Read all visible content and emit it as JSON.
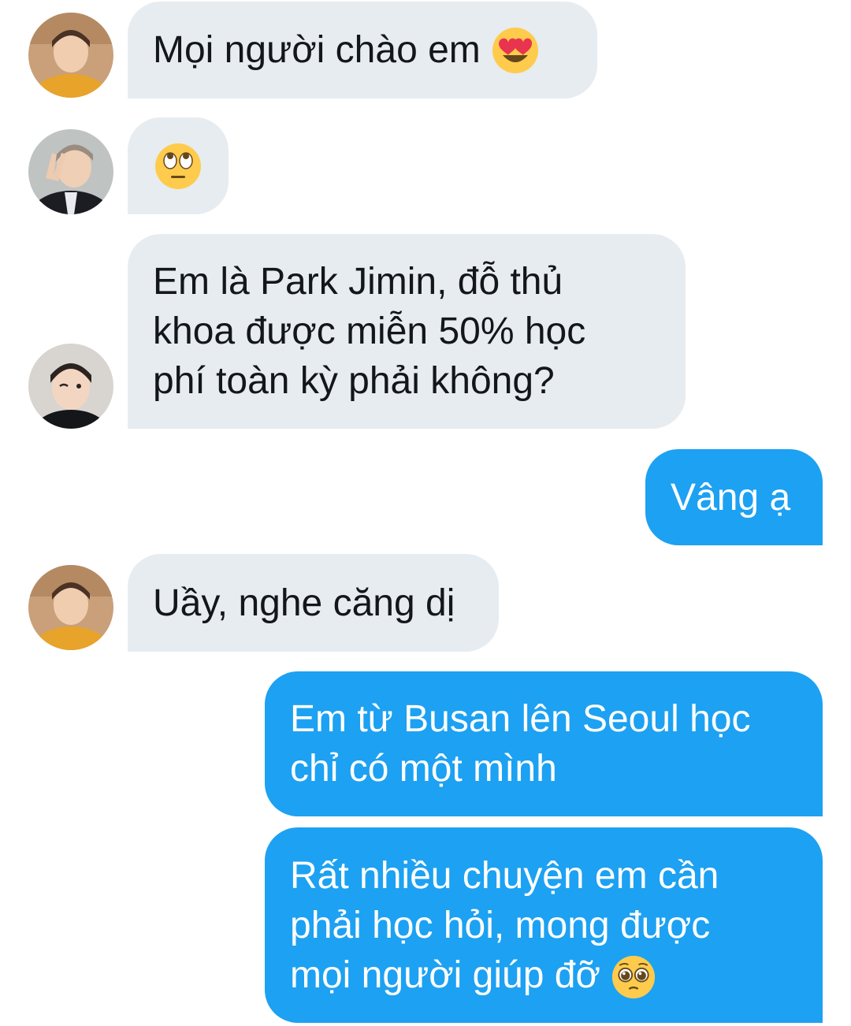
{
  "conversation": {
    "messages": [
      {
        "sender": "other",
        "avatar": "avatar-orange-hoodie",
        "text": "Mọi người chào em",
        "emoji": "heart-eyes-emoji"
      },
      {
        "sender": "other",
        "avatar": "avatar-peace-sign",
        "text": "",
        "emoji": "eye-roll-emoji"
      },
      {
        "sender": "other",
        "avatar": "avatar-wink",
        "text": "Em là Park Jimin, đỗ thủ\nkhoa được miễn 50% học\nphí toàn kỳ phải không?"
      },
      {
        "sender": "me",
        "text": "Vâng ạ"
      },
      {
        "sender": "other",
        "avatar": "avatar-orange-hoodie",
        "text": "Uầy, nghe căng dị"
      },
      {
        "sender": "me",
        "text": "Em từ Busan lên Seoul học\nchỉ có một mình"
      },
      {
        "sender": "me",
        "text": "Rất nhiều chuyện em cần\nphải học hỏi, mong được\nmọi người giúp đỡ",
        "emoji": "pleading-face-emoji"
      }
    ]
  },
  "colors": {
    "incoming_bubble": "#e6ecf0",
    "outgoing_bubble": "#1da1f2",
    "incoming_text": "#14171a",
    "outgoing_text": "#ffffff"
  }
}
